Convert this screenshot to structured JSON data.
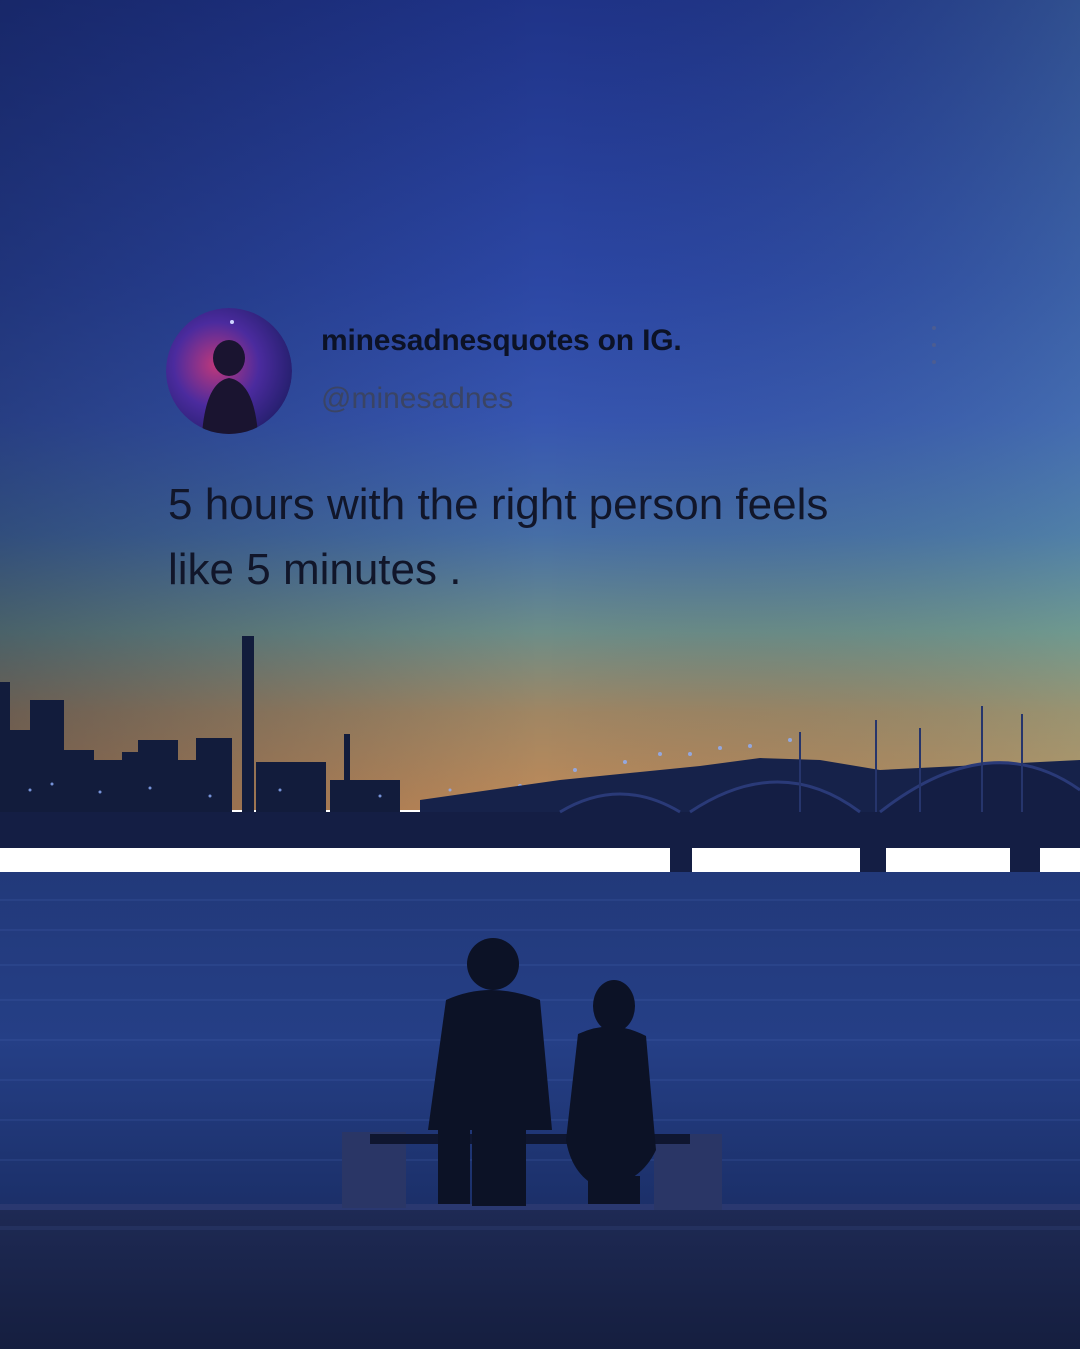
{
  "post": {
    "display_name": "minesadnesquotes on IG.",
    "handle": "@minesadnes",
    "avatar_icon": "profile-avatar-icon",
    "more_icon": "vertical-dots-icon",
    "text_lines": [
      "5 hours with the right person feels",
      "like 5 minutes ."
    ]
  },
  "background": {
    "sky_top": "#22358f",
    "sky_mid": "#3a5cb3",
    "horizon_teal": "#5f8f9c",
    "horizon_orange": "#b88a5a",
    "water": "#1e3470",
    "silhouette": "#0e1428"
  }
}
